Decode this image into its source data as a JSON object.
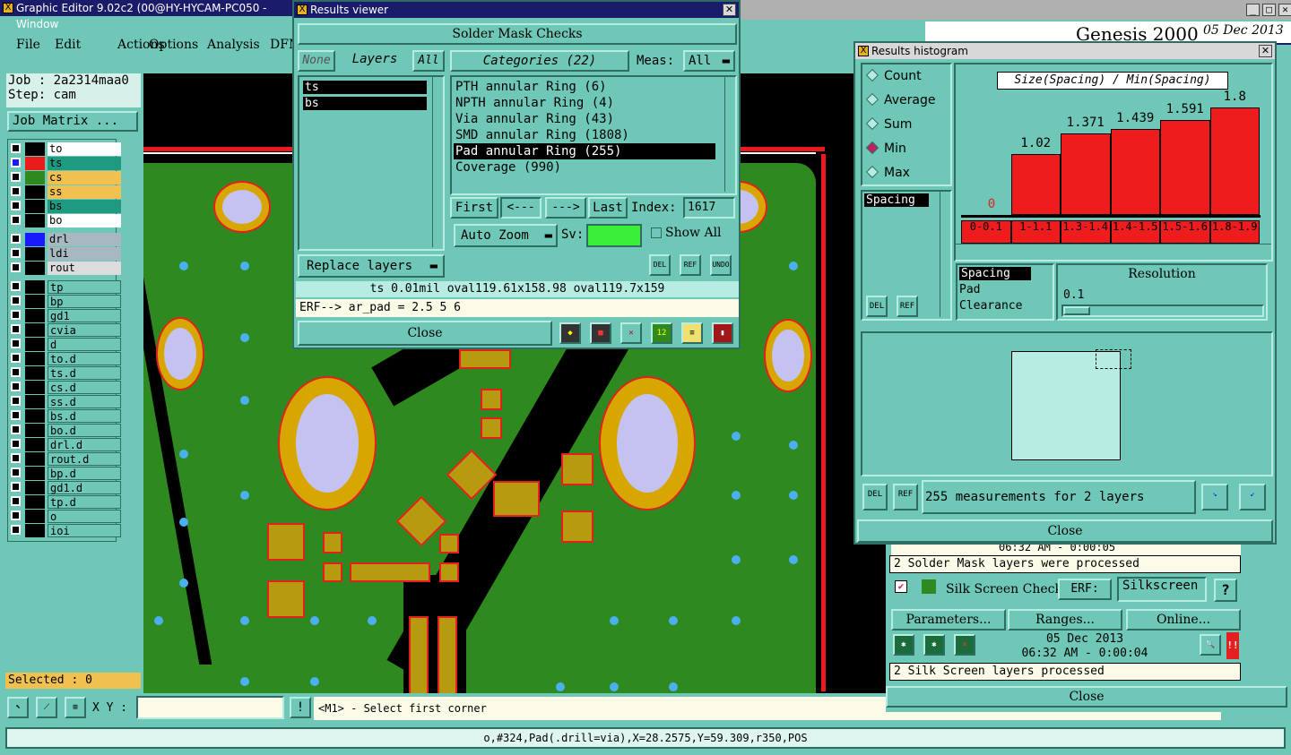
{
  "main": {
    "title": "Graphic Editor 9.02c2 (00@HY-HYCAM-PC050 - Window",
    "menu": [
      "File",
      "Edit",
      "Actions",
      "Options",
      "Analysis",
      "DFM"
    ],
    "job": "Job : 2a2314maa0",
    "step": "Step: cam",
    "job_matrix": "Job Matrix ...",
    "layers_a": [
      "to",
      "ts",
      "cs",
      "ss",
      "bs",
      "bo"
    ],
    "layers_b": [
      "drl",
      "ldi",
      "rout"
    ],
    "layers_c": [
      "tp",
      "bp",
      "gd1",
      "cvia",
      "d",
      "to.d",
      "ts.d",
      "cs.d",
      "ss.d",
      "bs.d",
      "bo.d",
      "drl.d",
      "rout.d",
      "bp.d",
      "gd1.d",
      "tp.d",
      "o",
      "ioi"
    ],
    "selected": "Selected : 0",
    "xy_label": "X Y :",
    "prompt": "<M1> - Select first corner",
    "status": "o,#324,Pad(.drill=via),X=28.2575,Y=59.309,r350,POS"
  },
  "results_viewer": {
    "title": "Results viewer",
    "header": "Solder Mask Checks",
    "none": "None",
    "layers_label": "Layers",
    "all": "All",
    "categories_label": "Categories (22)",
    "meas_label": "Meas:",
    "meas_value": "All",
    "layers": [
      "ts",
      "bs"
    ],
    "categories": [
      "PTH annular Ring (6)",
      "NPTH annular Ring (4)",
      "Via annular Ring (43)",
      "SMD annular Ring (1808)",
      "Pad annular Ring (255)",
      "Coverage (990)"
    ],
    "first": "First",
    "prev": "<---",
    "next": "--->",
    "last": "Last",
    "index_label": "Index:",
    "index_value": "1617",
    "auto_zoom": "Auto Zoom",
    "sv_label": "Sv:",
    "show_all": "Show All",
    "replace_layers": "Replace layers",
    "del": "DEL",
    "ref": "REF",
    "undo": "UNDO",
    "info": "ts 0.01mil  oval119.61x158.98  oval119.7x159",
    "erf": "ERF--> ar_pad = 2.5 5 6",
    "close": "Close"
  },
  "histogram": {
    "title": "Results histogram",
    "modes": [
      "Count",
      "Average",
      "Sum",
      "Min",
      "Max"
    ],
    "selected_mode": "Min",
    "chart_title": "Size(Spacing) / Min(Spacing)",
    "list1": [
      "Spacing"
    ],
    "list2": [
      "Spacing",
      "Pad",
      "Clearance"
    ],
    "resolution_label": "Resolution",
    "resolution_value": "0.1",
    "summary": "255 measurements for 2 layers",
    "close": "Close",
    "del": "DEL",
    "ref": "REF"
  },
  "chart_data": {
    "type": "bar",
    "title": "Size(Spacing) / Min(Spacing)",
    "categories": [
      "0-0.1",
      "1-1.1",
      "1.3-1.4",
      "1.4-1.5",
      "1.5-1.6",
      "1.8-1.9"
    ],
    "values": [
      0,
      1.02,
      1.371,
      1.439,
      1.591,
      1.8
    ],
    "ylim": [
      0,
      1.8
    ],
    "color": "#ee1c1c"
  },
  "genesis": {
    "brand": "Genesis 2000",
    "date": "05 Dec 2013",
    "time_frag": "06:32 AM - 0:00:05",
    "solder_msg": "2 Solder Mask layers were processed",
    "silk_title": "Silk Screen Checks",
    "erf_label": "ERF:",
    "erf_value": "Silkscreen",
    "help": "?",
    "parameters": "Parameters...",
    "ranges": "Ranges...",
    "online": "Online...",
    "silk_date": "05 Dec 2013",
    "silk_time": "06:32 AM - 0:00:04",
    "silk_msg": "2 Silk Screen layers processed",
    "close": "Close"
  }
}
